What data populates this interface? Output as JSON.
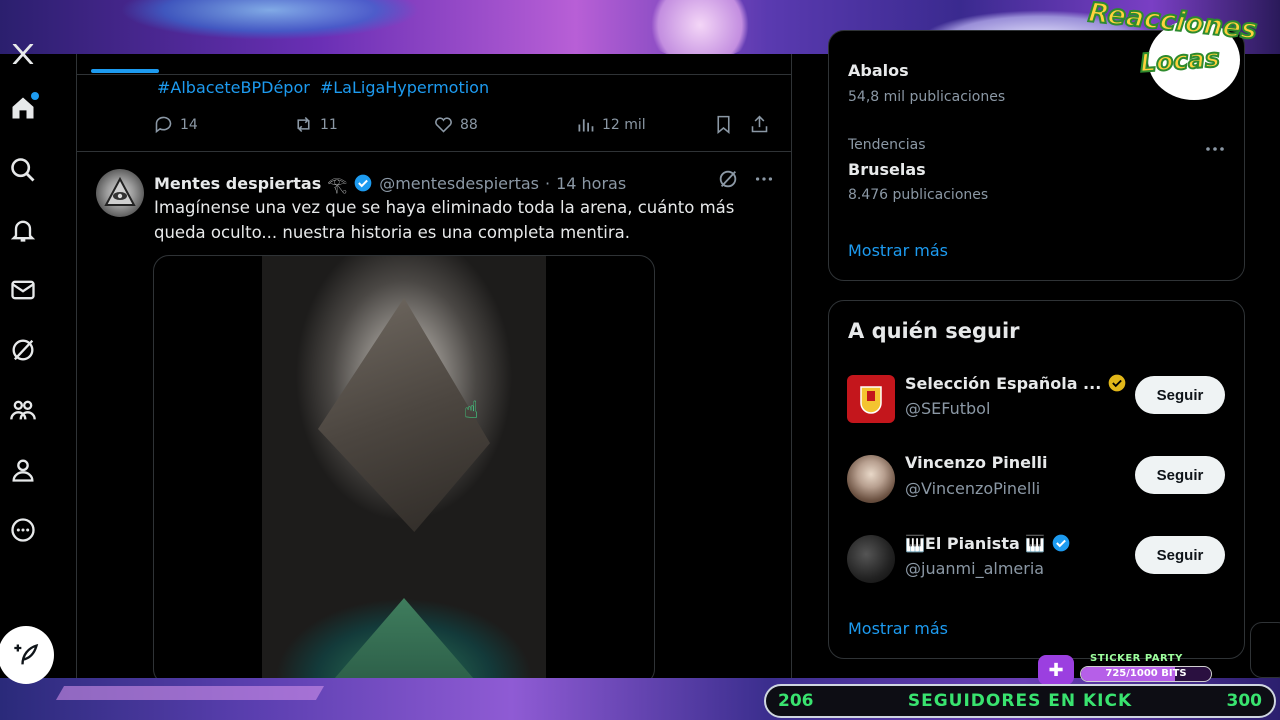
{
  "overlay": {
    "logo_line1": "Reacciones",
    "logo_line2": "Locas",
    "sticker_label": "STICKER PARTY",
    "sticker_progress_text": "725/1000 BITS",
    "sticker_progress": 0.725,
    "followers_left": "206",
    "followers_label": "SEGUIDORES EN KICK",
    "followers_right": "300",
    "accent_green": "#39e36f"
  },
  "nav": {
    "items": [
      {
        "icon": "x-logo-icon"
      },
      {
        "icon": "home-icon"
      },
      {
        "icon": "search-icon"
      },
      {
        "icon": "bell-icon"
      },
      {
        "icon": "mail-icon"
      },
      {
        "icon": "grok-icon"
      },
      {
        "icon": "communities-icon"
      },
      {
        "icon": "profile-icon"
      },
      {
        "icon": "more-icon"
      }
    ],
    "post_icon": "feather-plus-icon"
  },
  "previous_post": {
    "hashtags": [
      "#AlbaceteBPDépor",
      "#LaLigaHypermotion"
    ],
    "replies": "14",
    "reposts": "11",
    "likes": "88",
    "views": "12 mil"
  },
  "post": {
    "author_name": "Mentes despiertas",
    "author_emoji": "𓂀",
    "handle": "@mentesdespiertas",
    "separator": "·",
    "time": "14 horas",
    "text": "Imagínense una vez que se haya eliminado toda la arena, cuánto más queda oculto... nuestra historia es una completa mentira."
  },
  "trends": {
    "cut_name": "Abalos",
    "cut_count": "54,8 mil publicaciones",
    "trend_label": "Tendencias",
    "trend_name": "Bruselas",
    "trend_count": "8.476 publicaciones",
    "show_more": "Mostrar más"
  },
  "who_to_follow": {
    "title": "A quién seguir",
    "follow_label": "Seguir",
    "accounts": [
      {
        "name": "Selección Española ...",
        "handle": "@SEFutbol",
        "badge": "gold"
      },
      {
        "name": "Vincenzo Pinelli",
        "handle": "@VincenzoPinelli",
        "badge": "none"
      },
      {
        "name": "🎹El Pianista 🎹",
        "handle": "@juanmi_almeria",
        "badge": "blue"
      }
    ],
    "show_more": "Mostrar más"
  },
  "colors": {
    "link_blue": "#1d9bf0",
    "muted": "#8b98a5",
    "border": "#2f3336"
  }
}
